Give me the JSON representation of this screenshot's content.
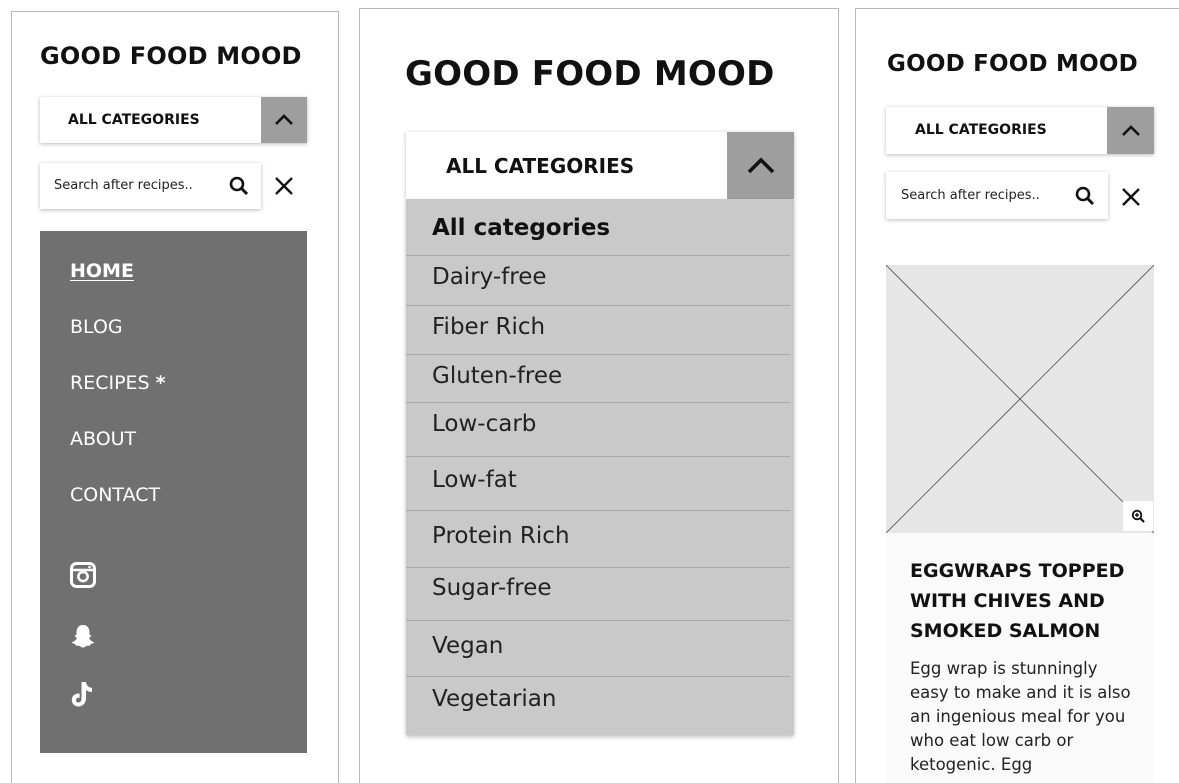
{
  "brand": {
    "title": "GOOD FOOD MOOD"
  },
  "category_select": {
    "label": "ALL CATEGORIES"
  },
  "search": {
    "placeholder": "Search after recipes.."
  },
  "nav": {
    "items": [
      {
        "label": "HOME"
      },
      {
        "label": "BLOG"
      },
      {
        "label": "RECIPES",
        "marker": "*"
      },
      {
        "label": "ABOUT"
      },
      {
        "label": "CONTACT"
      }
    ]
  },
  "social": [
    "instagram-icon",
    "snapchat-icon",
    "tiktok-icon"
  ],
  "categories": {
    "header": "All categories",
    "options": [
      "Dairy-free",
      "Fiber Rich",
      "Gluten-free",
      "Low-carb",
      "Low-fat",
      "Protein Rich",
      "Sugar-free",
      "Vegan",
      "Vegetarian"
    ]
  },
  "recipe_card": {
    "title": "EGGWRAPS TOPPED WITH CHIVES AND SMOKED SALMON",
    "excerpt": "Egg wrap is stunningly easy to make and it is also an ingenious meal for you who eat low carb or ketogenic. Egg"
  },
  "colors": {
    "nav_bg": "#707070",
    "dropdown_bg": "#c9c9c9",
    "chevron_button": "#9e9e9e",
    "image_placeholder": "#e6e6e6"
  }
}
